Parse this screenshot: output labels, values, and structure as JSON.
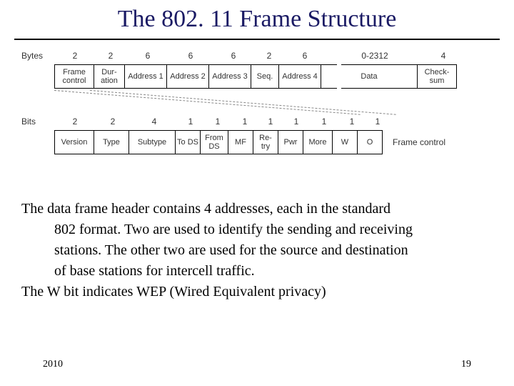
{
  "title": "The 802. 11 Frame Structure",
  "bytes_label": "Bytes",
  "bits_label": "Bits",
  "side_caption": "Frame control",
  "byte_sizes": [
    "2",
    "2",
    "6",
    "6",
    "6",
    "2",
    "6",
    "0-2312",
    "4"
  ],
  "byte_fields": [
    "Frame control",
    "Dur- ation",
    "Address 1",
    "Address 2",
    "Address 3",
    "Seq.",
    "Address 4",
    "Data",
    "Check- sum"
  ],
  "bit_sizes": [
    "2",
    "2",
    "4",
    "1",
    "1",
    "1",
    "1",
    "1",
    "1",
    "1",
    "1"
  ],
  "bit_fields": [
    "Version",
    "Type",
    "Subtype",
    "To DS",
    "From DS",
    "MF",
    "Re- try",
    "Pwr",
    "More",
    "W",
    "O"
  ],
  "para1_line1": "The data frame header contains 4 addresses, each in the standard",
  "para1_line2": "802 format. Two are used to identify the sending and receiving",
  "para1_line3": "stations. The other two are used for the source and destination",
  "para1_line4": "of base stations for intercell traffic.",
  "para2": "The W bit indicates WEP (Wired Equivalent privacy)",
  "footer_year": "2010",
  "footer_page": "19"
}
